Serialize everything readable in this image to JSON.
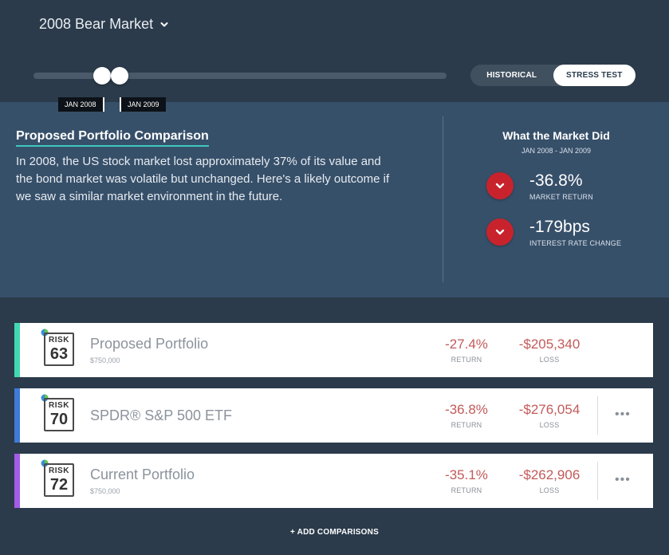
{
  "header": {
    "scenario_label": "2008 Bear Market",
    "slider": {
      "start_label": "JAN 2008",
      "end_label": "JAN 2009"
    },
    "mode_toggle": {
      "options": [
        "HISTORICAL",
        "STRESS TEST"
      ],
      "active": "STRESS TEST"
    }
  },
  "comparison": {
    "title": "Proposed Portfolio Comparison",
    "description": "In 2008, the US stock market lost approximately 37% of its value and the bond market was volatile but unchanged. Here's a likely outcome if we saw a similar market environment in the future."
  },
  "market": {
    "title": "What the Market Did",
    "range": "JAN 2008 - JAN 2009",
    "stats": [
      {
        "value": "-36.8%",
        "label": "MARKET RETURN",
        "icon": "chevron-down-icon"
      },
      {
        "value": "-179bps",
        "label": "INTEREST RATE CHANGE",
        "icon": "chevron-down-icon"
      }
    ]
  },
  "portfolios": [
    {
      "risk_label": "RISK",
      "risk": "63",
      "name": "Proposed Portfolio",
      "amount": "$750,000",
      "return": "-27.4%",
      "return_label": "RETURN",
      "loss": "-$205,340",
      "loss_label": "LOSS",
      "accent": "#42d9b2"
    },
    {
      "risk_label": "RISK",
      "risk": "70",
      "name": "SPDR® S&P 500 ETF",
      "amount": "",
      "return": "-36.8%",
      "return_label": "RETURN",
      "loss": "-$276,054",
      "loss_label": "LOSS",
      "accent": "#3f7bd8",
      "more": "•••"
    },
    {
      "risk_label": "RISK",
      "risk": "72",
      "name": "Current Portfolio",
      "amount": "$750,000",
      "return": "-35.1%",
      "return_label": "RETURN",
      "loss": "-$262,906",
      "loss_label": "LOSS",
      "accent": "#a35ce8",
      "more": "•••"
    }
  ],
  "footer": {
    "add_comparisons": "+ ADD COMPARISONS"
  },
  "colors": {
    "background": "#2b3b4b",
    "panel": "#37506a",
    "accent_teal": "#3fc6c0",
    "negative": "#c35a5a",
    "down_badge": "#c8232c"
  }
}
